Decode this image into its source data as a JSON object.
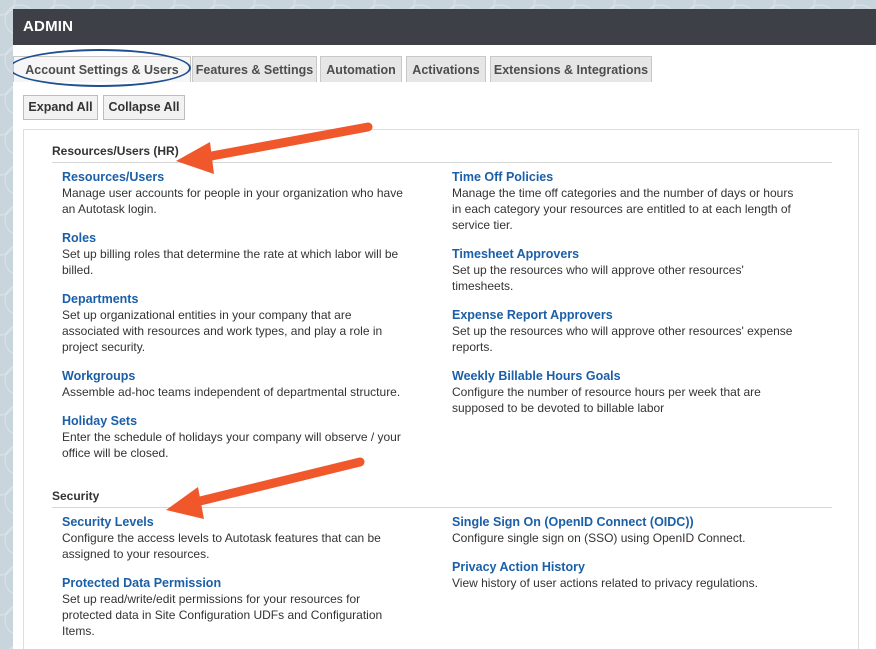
{
  "header": {
    "title": "ADMIN"
  },
  "tabs": [
    {
      "label": "Account Settings & Users"
    },
    {
      "label": "Features & Settings"
    },
    {
      "label": "Automation"
    },
    {
      "label": "Activations"
    },
    {
      "label": "Extensions & Integrations"
    }
  ],
  "toolbar": {
    "expand_all": "Expand All",
    "collapse_all": "Collapse All"
  },
  "sections": [
    {
      "title": "Resources/Users (HR)",
      "left": [
        {
          "title": "Resources/Users",
          "desc": "Manage user accounts for people in your organization who have an Autotask login."
        },
        {
          "title": "Roles",
          "desc": "Set up billing roles that determine the rate at which labor will be billed."
        },
        {
          "title": "Departments",
          "desc": "Set up organizational entities in your company that are associated with resources and work types, and play a role in project security."
        },
        {
          "title": "Workgroups",
          "desc": "Assemble ad-hoc teams independent of departmental structure."
        },
        {
          "title": "Holiday Sets",
          "desc": "Enter the schedule of holidays your company will observe / your office will be closed."
        }
      ],
      "right": [
        {
          "title": "Time Off Policies",
          "desc": "Manage the time off categories and the number of days or hours in each category your resources are entitled to at each length of service tier."
        },
        {
          "title": "Timesheet Approvers",
          "desc": "Set up the resources who will approve other resources' timesheets."
        },
        {
          "title": "Expense Report Approvers",
          "desc": "Set up the resources who will approve other resources' expense reports."
        },
        {
          "title": "Weekly Billable Hours Goals",
          "desc": "Configure the number of resource hours per week that are supposed to be devoted to billable labor"
        }
      ]
    },
    {
      "title": "Security",
      "left": [
        {
          "title": "Security Levels",
          "desc": "Configure the access levels to Autotask features that can be assigned to your resources."
        },
        {
          "title": "Protected Data Permission",
          "desc": "Set up read/write/edit permissions for your resources for protected data in Site Configuration UDFs and Configuration Items."
        }
      ],
      "right": [
        {
          "title": "Single Sign On (OpenID Connect (OIDC))",
          "desc": "Configure single sign on (SSO) using OpenID Connect."
        },
        {
          "title": "Privacy Action History",
          "desc": "View history of user actions related to privacy regulations."
        }
      ]
    }
  ],
  "colors": {
    "accent_link": "#1a5fa8",
    "header_bg": "#3d4046",
    "annotation_arrow": "#f0582c",
    "annotation_ring": "#1f4e91"
  }
}
